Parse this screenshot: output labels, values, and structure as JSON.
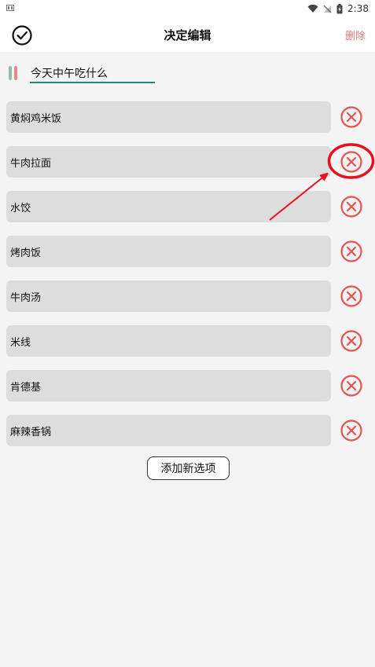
{
  "status_bar": {
    "time": "2:38",
    "icons": [
      "sim-icon",
      "wifi-icon",
      "signal-off-icon",
      "battery-charging-icon"
    ]
  },
  "app_bar": {
    "title": "决定编辑",
    "delete_label": "删除",
    "confirm_icon": "check-circle-icon"
  },
  "decision": {
    "title_value": "今天中午吃什么"
  },
  "options": [
    {
      "label": "黄焖鸡米饭"
    },
    {
      "label": "牛肉拉面"
    },
    {
      "label": "水饺"
    },
    {
      "label": "烤肉饭"
    },
    {
      "label": "牛肉汤"
    },
    {
      "label": "米线"
    },
    {
      "label": "肯德基"
    },
    {
      "label": "麻辣香锅"
    }
  ],
  "add_option_label": "添加新选项",
  "colors": {
    "remove_icon": "#e8524f",
    "annotation": "#e8101c",
    "title_underline": "#1f8a7a",
    "delete_text": "#e07a78",
    "accent_green": "#8fbfa9",
    "accent_red": "#e7898a"
  },
  "annotation": {
    "highlighted_option": "牛肉拉面"
  }
}
